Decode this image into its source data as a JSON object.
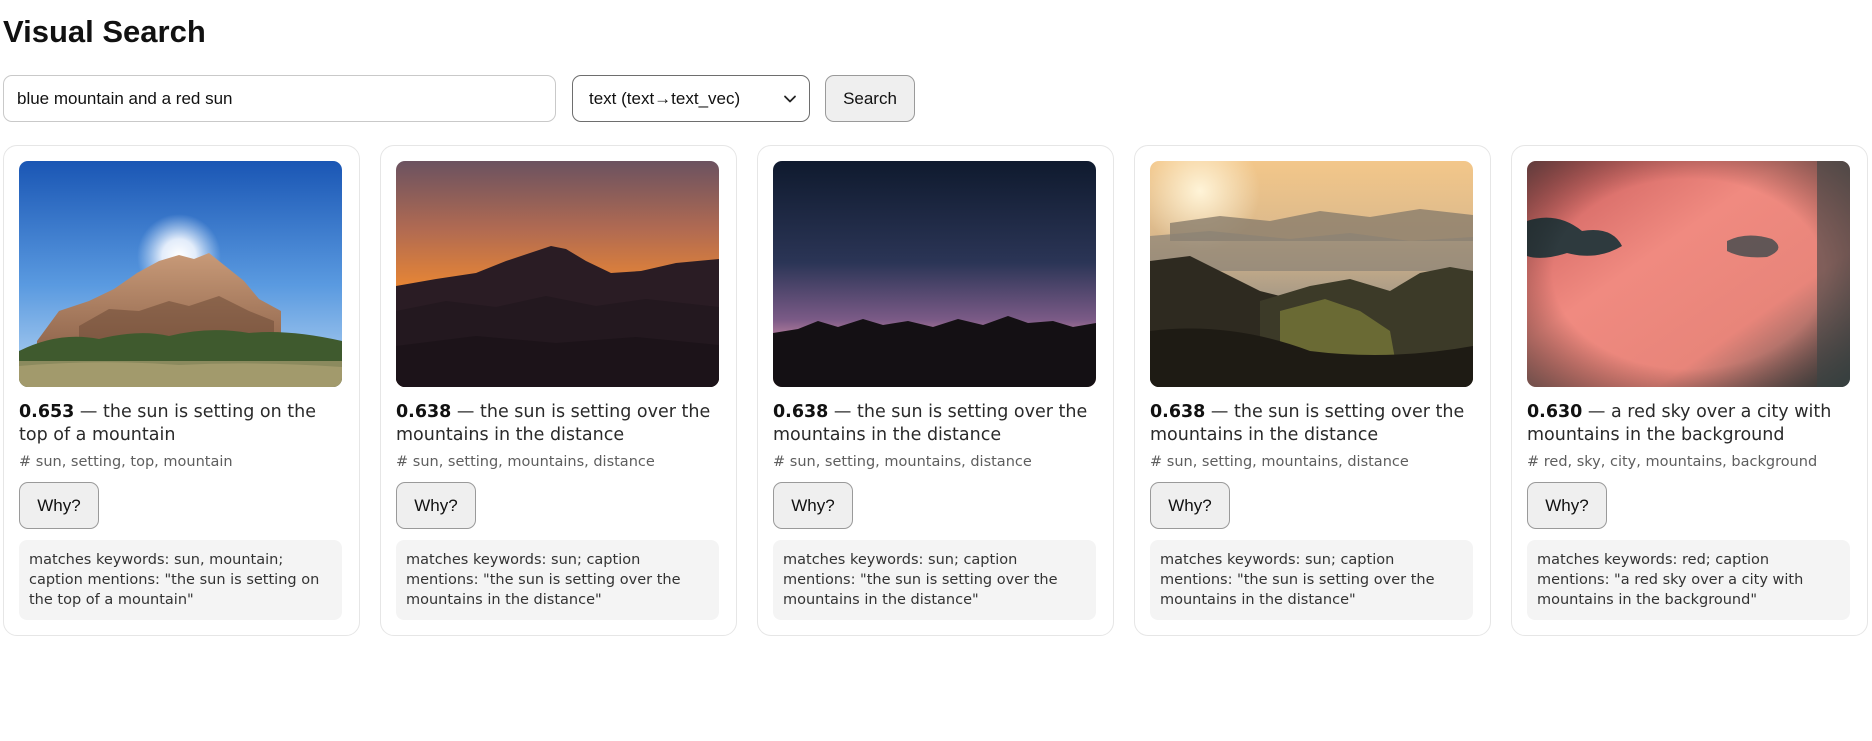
{
  "page": {
    "title": "Visual Search"
  },
  "search": {
    "query": "blue mountain and a red sun",
    "mode_selected": "text (text→text_vec)",
    "button_label": "Search"
  },
  "results": [
    {
      "score": "0.653",
      "caption": " — the sun is setting on the top of a mountain",
      "tags": "# sun, setting, top, mountain",
      "why_label": "Why?",
      "explanation": "matches keywords: sun, mountain; caption mentions: \"the sun is setting on the top of a mountain\""
    },
    {
      "score": "0.638",
      "caption": " — the sun is setting over the mountains in the distance",
      "tags": "# sun, setting, mountains, distance",
      "why_label": "Why?",
      "explanation": "matches keywords: sun; caption mentions: \"the sun is setting over the mountains in the distance\""
    },
    {
      "score": "0.638",
      "caption": " — the sun is setting over the mountains in the distance",
      "tags": "# sun, setting, mountains, distance",
      "why_label": "Why?",
      "explanation": "matches keywords: sun; caption mentions: \"the sun is setting over the mountains in the distance\""
    },
    {
      "score": "0.638",
      "caption": " — the sun is setting over the mountains in the distance",
      "tags": "# sun, setting, mountains, distance",
      "why_label": "Why?",
      "explanation": "matches keywords: sun; caption mentions: \"the sun is setting over the mountains in the distance\""
    },
    {
      "score": "0.630",
      "caption": " — a red sky over a city with mountains in the background",
      "tags": "# red, sky, city, mountains, background",
      "why_label": "Why?",
      "explanation": "matches keywords: red; caption mentions: \"a red sky over a city with mountains in the background\""
    }
  ]
}
